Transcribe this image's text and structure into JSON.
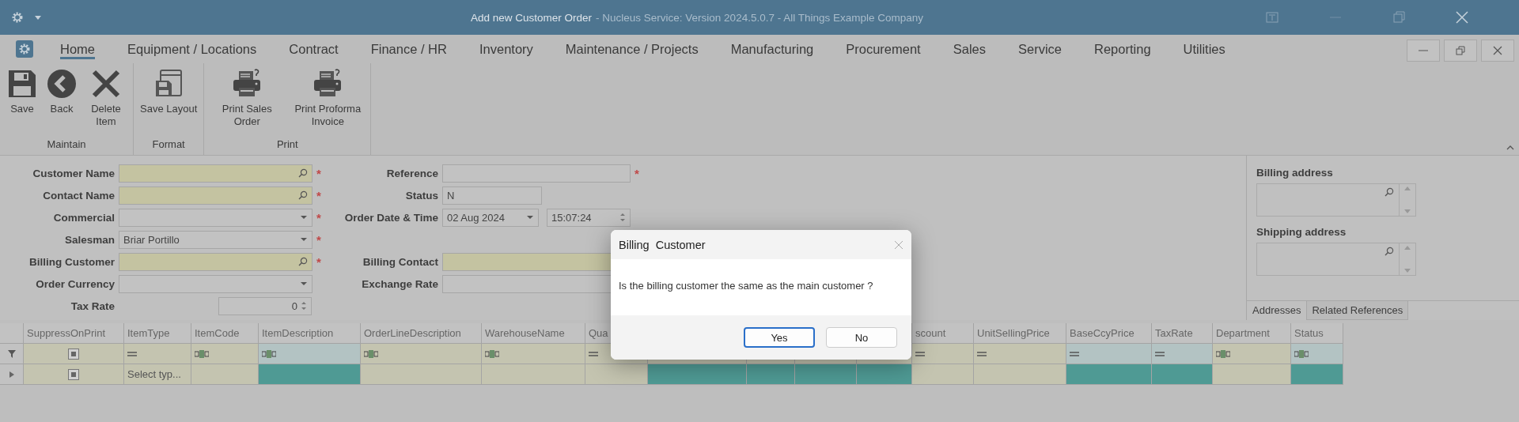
{
  "window": {
    "title": "Add new Customer Order",
    "subtitle": "- Nucleus Service: Version 2024.5.0.7 - All Things Example Company"
  },
  "ribbon": {
    "tabs": [
      {
        "label": "Home",
        "selected": true
      },
      {
        "label": "Equipment / Locations",
        "selected": false
      },
      {
        "label": "Contract",
        "selected": false
      },
      {
        "label": "Finance / HR",
        "selected": false
      },
      {
        "label": "Inventory",
        "selected": false
      },
      {
        "label": "Maintenance / Projects",
        "selected": false
      },
      {
        "label": "Manufacturing",
        "selected": false
      },
      {
        "label": "Procurement",
        "selected": false
      },
      {
        "label": "Sales",
        "selected": false
      },
      {
        "label": "Service",
        "selected": false
      },
      {
        "label": "Reporting",
        "selected": false
      },
      {
        "label": "Utilities",
        "selected": false
      }
    ],
    "groups": [
      {
        "label": "Maintain",
        "buttons": [
          {
            "label": "Save",
            "kind": "save"
          },
          {
            "label": "Back",
            "kind": "back"
          },
          {
            "label": "Delete Item",
            "kind": "delete"
          }
        ]
      },
      {
        "label": "Format",
        "buttons": [
          {
            "label": "Save Layout",
            "kind": "layout"
          }
        ]
      },
      {
        "label": "Print",
        "buttons": [
          {
            "label": "Print Sales Order",
            "kind": "print"
          },
          {
            "label": "Print Proforma Invoice",
            "kind": "print"
          }
        ]
      }
    ]
  },
  "form": {
    "left": [
      {
        "label": "Customer Name",
        "kind": "lookup",
        "mark": "*"
      },
      {
        "label": "Contact Name",
        "kind": "lookup",
        "mark": "*"
      },
      {
        "label": "Commercial",
        "kind": "dropdown",
        "mark": "*"
      },
      {
        "label": "Salesman",
        "kind": "dropdown",
        "value": "Briar Portillo",
        "mark": "*"
      },
      {
        "label": "Billing Customer",
        "kind": "lookup",
        "mark": "*"
      },
      {
        "label": "Order Currency",
        "kind": "dropdown"
      },
      {
        "label": "Tax Rate",
        "kind": "spin",
        "value": "0"
      }
    ],
    "right_top": [
      {
        "label": "Reference",
        "kind": "text",
        "mark": "*"
      },
      {
        "label": "Status",
        "kind": "readonly",
        "value": "N"
      },
      {
        "label": "Order Date & Time",
        "kind": "datetime",
        "value": "02 Aug 2024",
        "time": "15:07:24"
      }
    ],
    "right_bottom": [
      {
        "label": "Billing Contact",
        "kind": "highlighted"
      },
      {
        "label": "Exchange Rate",
        "kind": "text"
      }
    ]
  },
  "addresses": {
    "fields": [
      {
        "label": "Billing address"
      },
      {
        "label": "Shipping address"
      }
    ],
    "tabs": [
      {
        "label": "Addresses",
        "selected": true
      },
      {
        "label": "Related References",
        "selected": false
      }
    ]
  },
  "grid": {
    "columns": [
      {
        "header": "SuppressOnPrint",
        "filter": {
          "kind": "checkbox"
        },
        "cell": {
          "kind": "checkbox"
        }
      },
      {
        "header": "ItemType",
        "filter": {
          "kind": "equals"
        },
        "cell": {
          "text": "Select typ..."
        }
      },
      {
        "header": "ItemCode",
        "filter": {
          "kind": "abc"
        }
      },
      {
        "header": "ItemDescription",
        "filter": {
          "kind": "abc",
          "color": "#b3c3c3"
        },
        "cell": {
          "color": "#4f9a94"
        }
      },
      {
        "header": "OrderLineDescription",
        "filter": {
          "kind": "abc"
        }
      },
      {
        "header": "WarehouseName",
        "filter": {
          "kind": "abc"
        }
      },
      {
        "header": "Qua",
        "filter": {
          "kind": "equals"
        }
      },
      {
        "cell": {
          "color": "#4f9a94"
        }
      },
      {
        "cell": {
          "color": "#4f9a94"
        }
      },
      {
        "cell": {
          "color": "#4f9a94"
        }
      },
      {
        "cell": {
          "color": "#4f9a94"
        }
      },
      {
        "header": "scount",
        "filter": {
          "kind": "equals"
        }
      },
      {
        "header": "UnitSellingPrice",
        "filter": {
          "kind": "equals"
        }
      },
      {
        "header": "BaseCcyPrice",
        "filter": {
          "kind": "equals",
          "color": "#b3c3c3"
        },
        "cell": {
          "color": "#4f9a94"
        }
      },
      {
        "header": "TaxRate",
        "filter": {
          "kind": "equals",
          "color": "#b3c3c3"
        },
        "cell": {
          "color": "#4f9a94"
        }
      },
      {
        "header": "Department",
        "filter": {
          "kind": "abc"
        }
      },
      {
        "header": "Status",
        "filter": {
          "kind": "abc",
          "color": "#b3c3c3"
        },
        "cell": {
          "color": "#4f9a94"
        }
      }
    ]
  },
  "dialog": {
    "title": "Billing  Customer",
    "message": "Is the billing customer the same as the main customer ?",
    "buttons": [
      {
        "label": "Yes",
        "focused": true
      },
      {
        "label": "No",
        "focused": false
      }
    ]
  }
}
